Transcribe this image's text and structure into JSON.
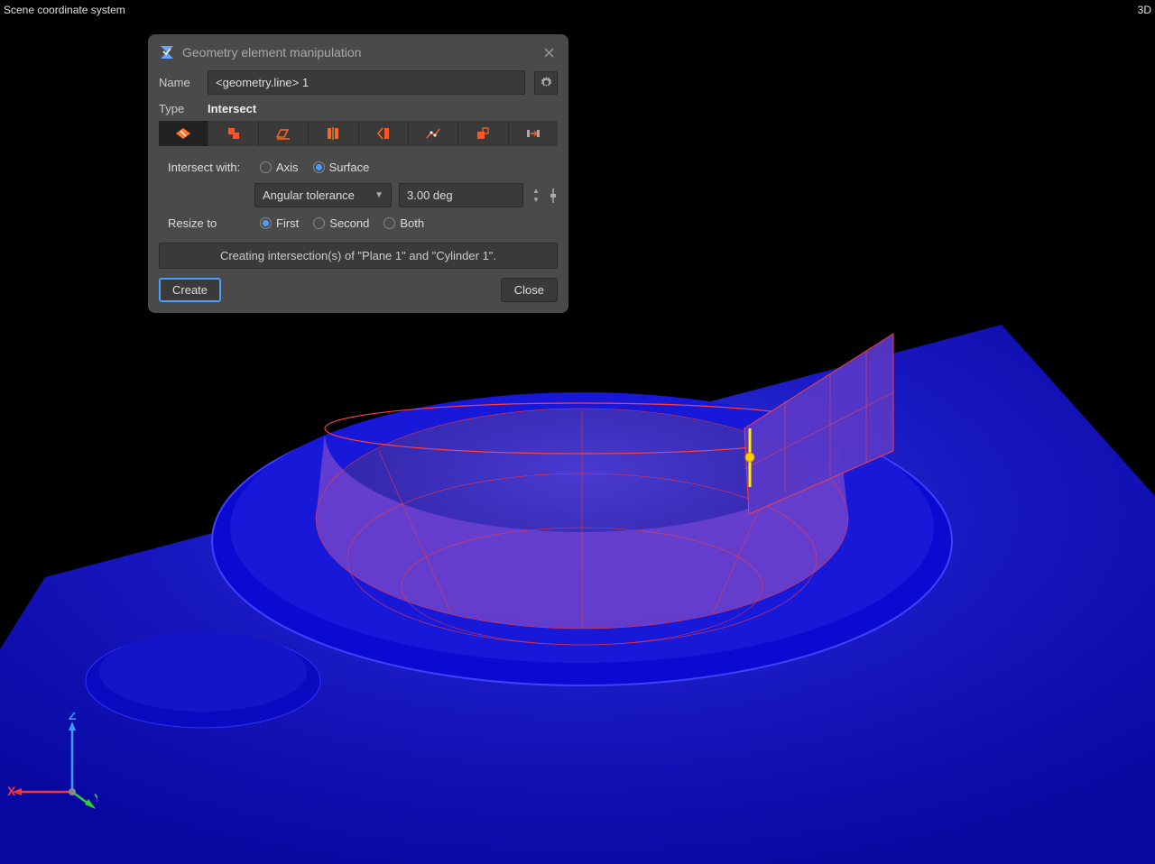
{
  "topbar": {
    "left": "Scene coordinate system",
    "right": "3D"
  },
  "dialog": {
    "title": "Geometry element manipulation",
    "name_label": "Name",
    "name_value": "<geometry.line> 1",
    "type_label": "Type",
    "type_value": "Intersect",
    "type_buttons": [
      {
        "id": "intersect",
        "active": true
      },
      {
        "id": "offset",
        "active": false
      },
      {
        "id": "project",
        "active": false
      },
      {
        "id": "mirror",
        "active": false
      },
      {
        "id": "rotate",
        "active": false
      },
      {
        "id": "connect",
        "active": false
      },
      {
        "id": "trim",
        "active": false
      },
      {
        "id": "extend",
        "active": false
      }
    ],
    "intersect_with_label": "Intersect with:",
    "intersect_options": {
      "axis": "Axis",
      "surface": "Surface",
      "selected": "surface"
    },
    "tolerance_mode": "Angular tolerance",
    "tolerance_value": "3.00 deg",
    "resize_label": "Resize to",
    "resize_options": {
      "first": "First",
      "second": "Second",
      "both": "Both",
      "selected": "first"
    },
    "status": "Creating intersection(s) of \"Plane 1\" and \"Cylinder 1\".",
    "create_btn": "Create",
    "close_btn": "Close"
  },
  "axes": {
    "x": "X",
    "y": "Y",
    "z": "Z"
  }
}
